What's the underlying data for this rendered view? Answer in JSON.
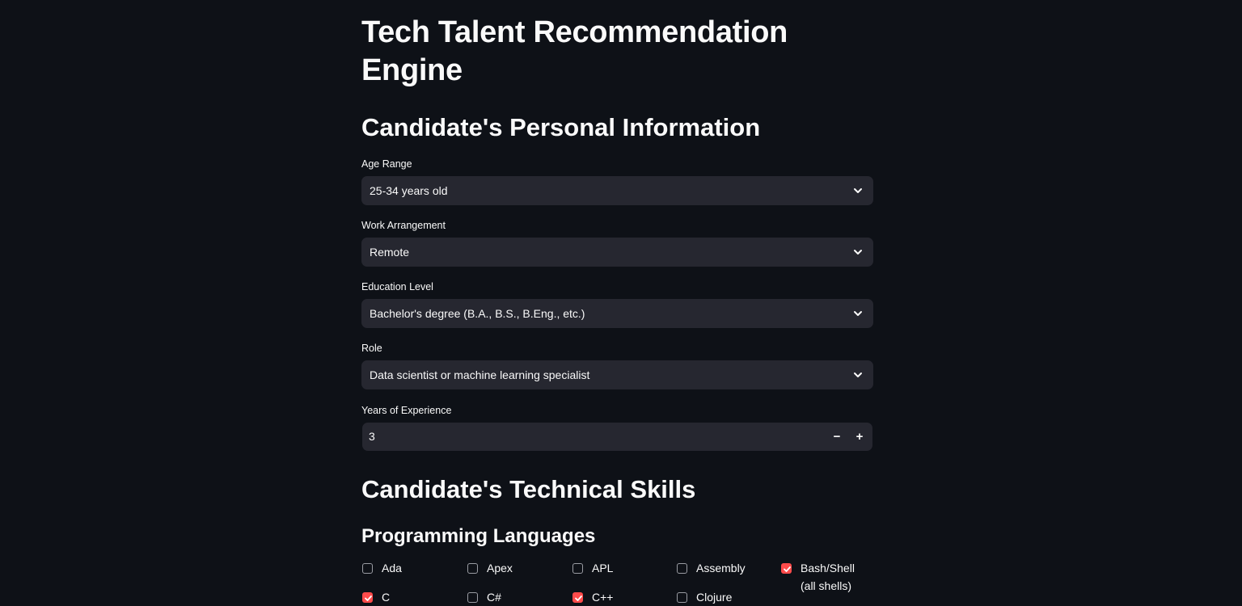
{
  "page": {
    "title": "Tech Talent Recommendation Engine"
  },
  "personal": {
    "heading": "Candidate's Personal Information",
    "age_range": {
      "label": "Age Range",
      "value": "25-34 years old"
    },
    "work_arrangement": {
      "label": "Work Arrangement",
      "value": "Remote"
    },
    "education_level": {
      "label": "Education Level",
      "value": "Bachelor's degree (B.A., B.S., B.Eng., etc.)"
    },
    "role": {
      "label": "Role",
      "value": "Data scientist or machine learning specialist"
    },
    "years_experience": {
      "label": "Years of Experience",
      "value": "3",
      "decrement": "−",
      "increment": "+"
    }
  },
  "skills": {
    "heading": "Candidate's Technical Skills",
    "programming_languages": {
      "heading": "Programming Languages",
      "items": [
        {
          "label": "Ada",
          "checked": false
        },
        {
          "label": "Apex",
          "checked": false
        },
        {
          "label": "APL",
          "checked": false
        },
        {
          "label": "Assembly",
          "checked": false
        },
        {
          "label": "Bash/Shell (all shells)",
          "checked": true
        },
        {
          "label": "C",
          "checked": true
        },
        {
          "label": "C#",
          "checked": false
        },
        {
          "label": "C++",
          "checked": true
        },
        {
          "label": "Clojure",
          "checked": false
        }
      ]
    }
  },
  "colors": {
    "background": "#0e1117",
    "input_bg": "#262730",
    "accent": "#ff4b4b",
    "text": "#fafafa"
  }
}
